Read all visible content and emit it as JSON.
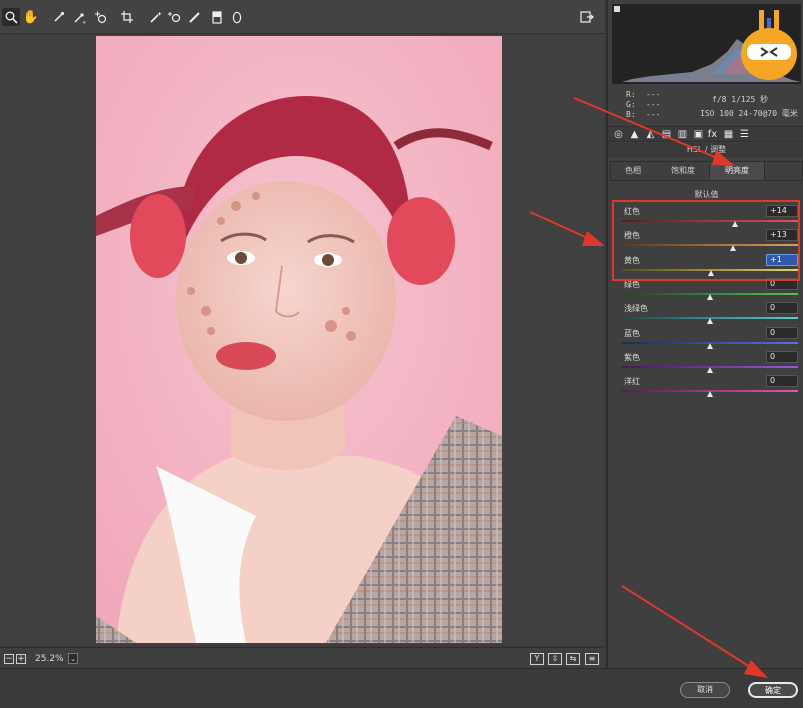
{
  "toolbar": {
    "tools": [
      "zoom-icon",
      "hand-icon",
      "white-balance-icon",
      "color-sampler-icon",
      "target-adjust-icon",
      "crop-icon",
      "spot-removal-icon",
      "red-eye-icon",
      "adjustment-brush-icon",
      "graduated-filter-icon",
      "radial-filter-icon"
    ],
    "exit_icon": "open-full-icon"
  },
  "canvas_bar": {
    "zoom_level": "25.2%",
    "zoom_out": "−",
    "zoom_in": "+",
    "zoom_dropdown": "⌄",
    "view_buttons": [
      "Y",
      "⇳",
      "⇆",
      "≡"
    ]
  },
  "info": {
    "r_label": "R:",
    "g_label": "G:",
    "b_label": "B:",
    "r_value": "---",
    "g_value": "---",
    "b_value": "---",
    "exif_line1": "f/8   1/125 秒",
    "exif_line2": "ISO 100   24-70@70 毫米"
  },
  "panel": {
    "title": "HSL / 调整",
    "subtabs": [
      "色相",
      "饱和度",
      "明亮度"
    ],
    "active_subtab": "明亮度",
    "defaults_link": "默认值",
    "sliders": [
      {
        "label": "红色",
        "value": "+14",
        "position": 0.64,
        "gradient": "linear-gradient(90deg,#5a1e1e,#e05252)"
      },
      {
        "label": "橙色",
        "value": "+13",
        "position": 0.63,
        "gradient": "linear-gradient(90deg,#5a3a1e,#e0a052)"
      },
      {
        "label": "黄色",
        "value": "+1",
        "position": 0.505,
        "gradient": "linear-gradient(90deg,#555020,#e0d852)",
        "focused": true
      },
      {
        "label": "绿色",
        "value": "0",
        "position": 0.5,
        "gradient": "linear-gradient(90deg,#1e4a1e,#52c052)"
      },
      {
        "label": "浅绿色",
        "value": "0",
        "position": 0.5,
        "gradient": "linear-gradient(90deg,#1e4a48,#52d0c8)"
      },
      {
        "label": "蓝色",
        "value": "0",
        "position": 0.5,
        "gradient": "linear-gradient(90deg,#1e2a5a,#5272e0)"
      },
      {
        "label": "紫色",
        "value": "0",
        "position": 0.5,
        "gradient": "linear-gradient(90deg,#3e1e5a,#a052e0)"
      },
      {
        "label": "洋红",
        "value": "0",
        "position": 0.5,
        "gradient": "linear-gradient(90deg,#5a1e4a,#e052c0)"
      }
    ]
  },
  "footer": {
    "cancel_label": "取消",
    "ok_label": "确定"
  },
  "colors": {
    "annotation_red": "#e0372b",
    "photo_background": "#f4b6c5"
  }
}
